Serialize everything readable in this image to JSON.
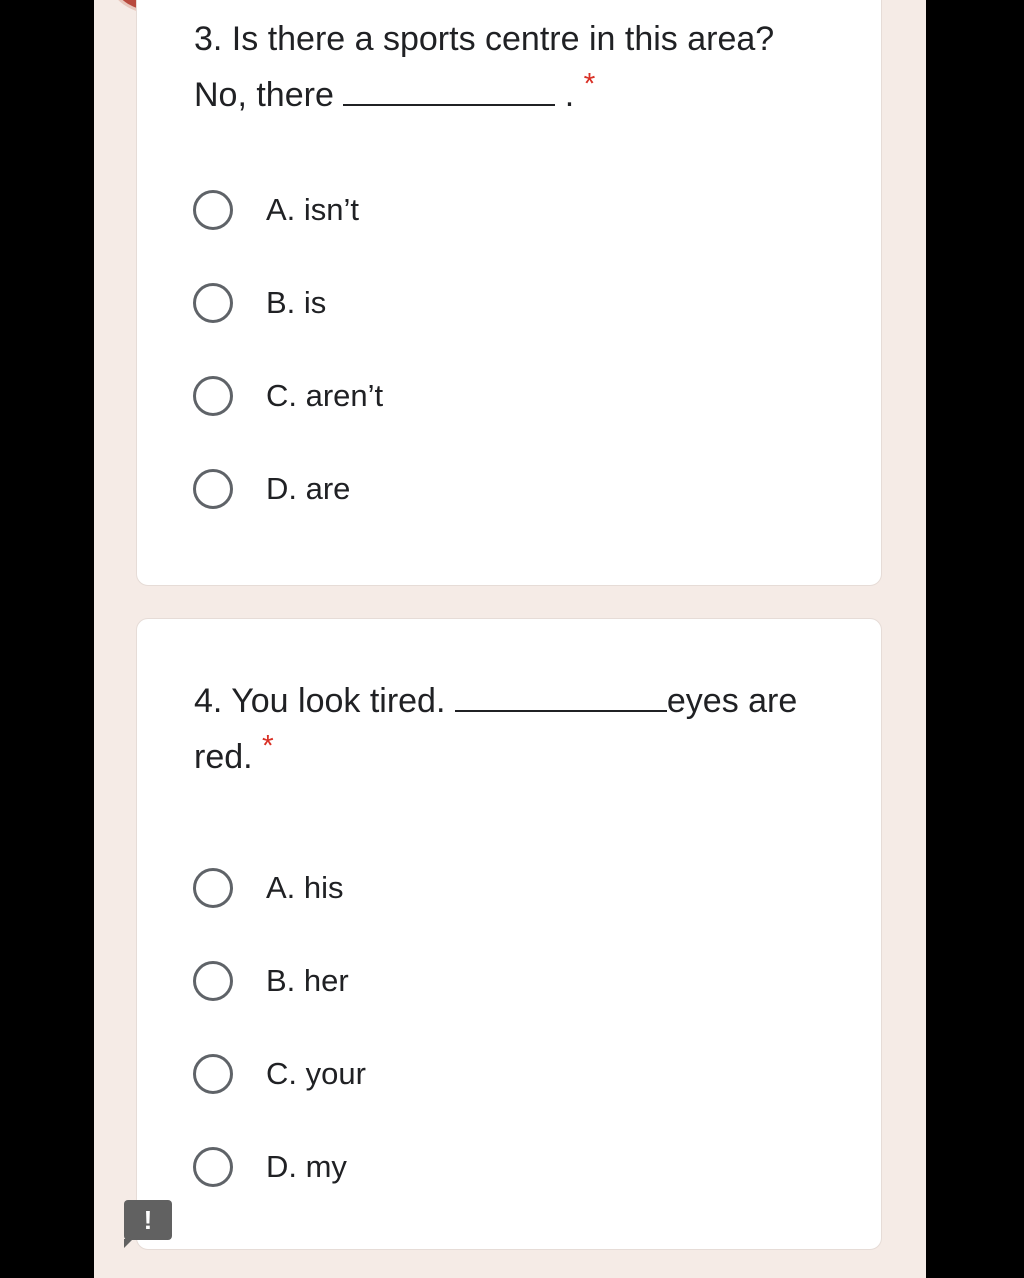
{
  "form": {
    "questions": [
      {
        "prefix": "3. Is there a sports centre in this area? No, there ",
        "suffix": " .",
        "required_mark": "*",
        "options": [
          "A. isn’t",
          "B. is",
          "C. aren’t",
          "D. are"
        ]
      },
      {
        "prefix": "4. You look tired. ",
        "suffix": "eyes are red.",
        "required_mark": "*",
        "options": [
          "A. his",
          "B. her",
          "C. your",
          "D. my"
        ]
      }
    ]
  },
  "feedback": {
    "glyph": "!",
    "icon": "feedback-icon"
  },
  "colors": {
    "page_bg": "#f5ebe6",
    "card_bg": "#ffffff",
    "required": "#d93025",
    "radio_border": "#5f6368"
  }
}
